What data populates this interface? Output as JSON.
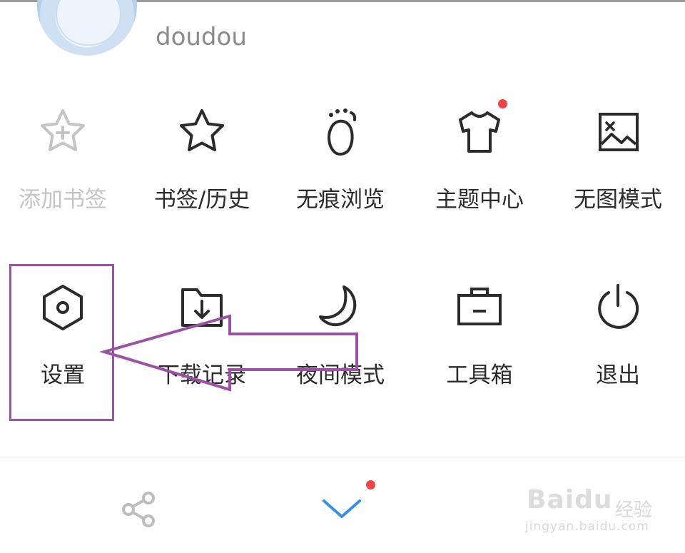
{
  "profile": {
    "username": "doudou"
  },
  "menu_row1": [
    {
      "label": "添加书签",
      "icon": "star-plus-icon",
      "disabled": true
    },
    {
      "label": "书签/历史",
      "icon": "star-icon"
    },
    {
      "label": "无痕浏览",
      "icon": "footprint-icon"
    },
    {
      "label": "主题中心",
      "icon": "tshirt-icon",
      "badge": true
    },
    {
      "label": "无图模式",
      "icon": "no-image-icon"
    }
  ],
  "menu_row2": [
    {
      "label": "设置",
      "icon": "hexagon-gear-icon"
    },
    {
      "label": "下载记录",
      "icon": "download-folder-icon"
    },
    {
      "label": "夜间模式",
      "icon": "moon-icon"
    },
    {
      "label": "工具箱",
      "icon": "toolbox-icon"
    },
    {
      "label": "退出",
      "icon": "power-icon"
    }
  ],
  "bottom_bar": {
    "share_icon": "share-icon",
    "collapse_icon": "chevron-down-icon",
    "collapse_badge": true
  },
  "watermark": {
    "brand": "Baidu",
    "brand_cn": "经验",
    "url": "jingyan.baidu.com"
  },
  "colors": {
    "annotation": "#9b52a5",
    "badge": "#f04545",
    "accent": "#3a8ee6",
    "icon": "#2b2b2b",
    "disabled": "#c4c4c4"
  }
}
